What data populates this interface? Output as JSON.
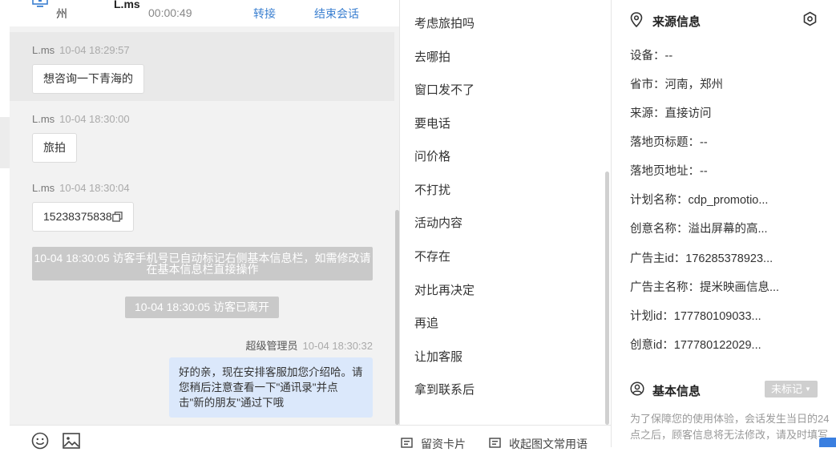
{
  "header": {
    "city": "州",
    "visitor_name": "L.ms",
    "duration": "00:00:49",
    "transfer_label": "转接",
    "end_label": "结束会话"
  },
  "messages": [
    {
      "sender": "L.ms",
      "time": "10-04 18:29:57",
      "text": "想咨询一下青海的"
    },
    {
      "sender": "L.ms",
      "time": "10-04 18:30:00",
      "text": "旅拍"
    },
    {
      "sender": "L.ms",
      "time": "10-04 18:30:04",
      "text": "15238375838"
    }
  ],
  "system_notices": {
    "phone_marked": "10-04 18:30:05 访客手机号已自动标记右侧基本信息栏，如需修改请在基本信息栏直接操作",
    "left": "10-04 18:30:05 访客已离开"
  },
  "agent_message": {
    "sender": "超级管理员",
    "time": "10-04 18:30:32",
    "text": "好的亲，现在安排客服加您介绍哈。请您稍后注意查看一下\"通讯录\"并点击\"新的朋友\"通过下哦"
  },
  "phrases": [
    "考虑旅拍吗",
    "去哪拍",
    "窗口发不了",
    "要电话",
    "问价格",
    "不打扰",
    "活动内容",
    "不存在",
    "对比再决定",
    "再追",
    "让加客服",
    "拿到联系后"
  ],
  "source_info": {
    "title": "来源信息",
    "rows": [
      "设备：--",
      "省市：河南，郑州",
      "来源：直接访问",
      "落地页标题：--",
      "落地页地址：--",
      "计划名称：cdp_promotio...",
      "创意名称：溢出屏幕的高...",
      "广告主id：176285378923...",
      "广告主名称：提米映画信息...",
      "计划id：177780109033...",
      "创意id：177780122029..."
    ]
  },
  "basic_info": {
    "title": "基本信息",
    "tag_label": "未标记",
    "note": "为了保障您的使用体验，会话发生当日的24点之后，顾客信息将无法修改，请及时填写"
  },
  "toolbar": {
    "card_label": "留资卡片",
    "phrase_label": "收起图文常用语"
  },
  "colors": {
    "link": "#3a7fd0",
    "agent_bubble": "#dbe8fb",
    "system_notice": "#c9c9c9"
  }
}
